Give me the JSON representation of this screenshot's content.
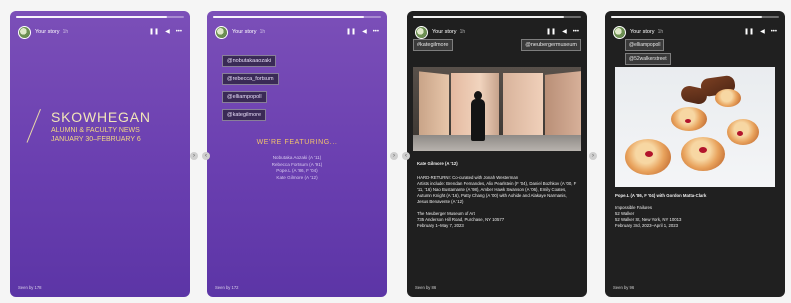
{
  "stories": [
    {
      "user": "Your story",
      "time": "1h",
      "progress": 0.9,
      "seen": "Seen by 178",
      "title": "SKOWHEGAN",
      "subtitle": "ALUMNI & FACULTY NEWS",
      "dates": "JANUARY 30–FEBRUARY 6"
    },
    {
      "user": "Your story",
      "time": "1h",
      "progress": 0.9,
      "seen": "Seen by 172",
      "tags": [
        "@nobutakaaozaki",
        "@rebecca_fortsum",
        "@elliampopoll",
        "@kategilmore"
      ],
      "featuring": "WE'RE FEATURING...",
      "featured": [
        "Nobutaka Aozaki (A '11)",
        "Rebecca Fortsum (A '91)",
        "Pope.L (A '86, F '04)",
        "Kate Gilmore (A '12)"
      ]
    },
    {
      "user": "Your story",
      "time": "1h",
      "progress": 0.9,
      "seen": "Seen by 86",
      "tags": [
        "#kategilmore",
        "@neubergermuseum"
      ],
      "name": "Kate Gilmore (A '12)",
      "body1": "HARD-RETURN!: Co-curated with Jonah Westerman",
      "body2": "Artists include: Brendan Fernandes, Alix Pearlstein (F '04), Daniel Bozhkov (A '00, F '11, '16) Nao Bustamante (A '98), Amber Hawk Swanson (A '06), Emily Coates, Autumn Knight (A '16), Patty Chang (A '00) with Aohide and Alakaye Narmanis, Jesus Benavente (A '12)",
      "venue": "The Neuberger Museum of Art",
      "address": "735 Anderson Hill Road, Purchase, NY 10577",
      "run": "February 1–May 7, 2023"
    },
    {
      "user": "Your story",
      "time": "1h",
      "progress": 0.9,
      "seen": "Seen by 96",
      "tags": [
        "@elliampopoll",
        "@52walkerstreet"
      ],
      "name": "Pope.L (A '86, F '04) with Gordon Matta-Clark",
      "body1": "Impossible Failures",
      "body2": "52 Walker",
      "address": "52 Walker St, New York, NY 10013",
      "run": "February 3rd, 2023–April 1, 2023"
    }
  ],
  "controls": {
    "pause": "❚❚",
    "mute": "◀",
    "more": "•••"
  },
  "nav": {
    "prev": "‹",
    "next": "›"
  }
}
